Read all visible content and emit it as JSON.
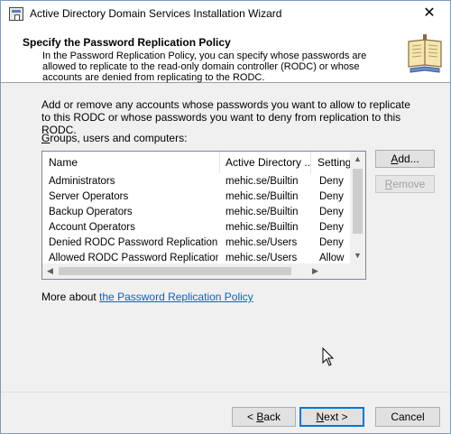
{
  "window": {
    "title": "Active Directory Domain Services Installation Wizard",
    "close_glyph": "✕"
  },
  "header": {
    "title": "Specify the Password Replication Policy",
    "description": "In the Password Replication Policy, you can specify whose passwords are allowed to replicate to the read-only domain controller (RODC) or whose accounts are denied from replicating to the RODC."
  },
  "content": {
    "intro": "Add or remove any accounts whose passwords you want to allow to replicate to this RODC or whose passwords you want to deny from replication to this RODC.",
    "list_label_prefix": "G",
    "list_label_rest": "roups, users and computers:",
    "columns": [
      "Name",
      "Active Directory ...",
      "Setting"
    ],
    "rows": [
      {
        "name": "Administrators",
        "ad": "mehic.se/Builtin",
        "setting": "Deny"
      },
      {
        "name": "Server Operators",
        "ad": "mehic.se/Builtin",
        "setting": "Deny"
      },
      {
        "name": "Backup Operators",
        "ad": "mehic.se/Builtin",
        "setting": "Deny"
      },
      {
        "name": "Account Operators",
        "ad": "mehic.se/Builtin",
        "setting": "Deny"
      },
      {
        "name": "Denied RODC Password Replication ...",
        "ad": "mehic.se/Users",
        "setting": "Deny"
      },
      {
        "name": "Allowed RODC Password Replication ...",
        "ad": "mehic.se/Users",
        "setting": "Allow"
      }
    ],
    "add_button": {
      "mnemonic": "A",
      "rest": "dd..."
    },
    "remove_button": {
      "mnemonic": "R",
      "rest": "emove"
    },
    "more_prefix": "More about ",
    "more_link": "the Password Replication Policy"
  },
  "footer": {
    "back": {
      "prefix": "< ",
      "mnemonic": "B",
      "rest": "ack"
    },
    "next": {
      "mnemonic": "N",
      "rest": "ext >"
    },
    "cancel": "Cancel"
  },
  "colors": {
    "accent": "#0078d7",
    "link": "#0066cc"
  },
  "icons": {
    "app": "wizard-app-icon",
    "header": "book-icon",
    "cursor": "mouse-pointer-icon"
  }
}
